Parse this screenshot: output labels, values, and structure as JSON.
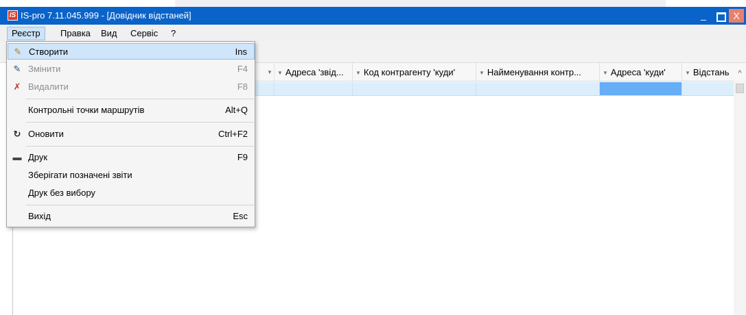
{
  "window": {
    "app_icon_text": "IS",
    "title": "IS-pro 7.11.045.999 - [Довідник відстаней]",
    "minimize_glyph": "_",
    "maximize_icon": "maximize-icon",
    "close_glyph": "X"
  },
  "menubar": {
    "items": [
      {
        "label": "Реєстр",
        "active": true
      },
      {
        "label": "Правка",
        "active": false
      },
      {
        "label": "Вид",
        "active": false
      },
      {
        "label": "Сервіс",
        "active": false
      },
      {
        "label": "?",
        "active": false
      }
    ]
  },
  "dropdown": {
    "items": [
      {
        "label": "Створити",
        "shortcut": "Ins",
        "icon": "new-document-icon",
        "glyph": "✎",
        "selected": true,
        "enabled": true
      },
      {
        "label": "Змінити",
        "shortcut": "F4",
        "icon": "edit-icon",
        "glyph": "✎",
        "selected": false,
        "enabled": false
      },
      {
        "label": "Видалити",
        "shortcut": "F8",
        "icon": "delete-icon",
        "glyph": "✗",
        "selected": false,
        "enabled": false
      },
      {
        "label": "Контрольні точки маршрутів",
        "shortcut": "Alt+Q",
        "icon": "",
        "selected": false,
        "enabled": true
      },
      {
        "label": "Оновити",
        "shortcut": "Ctrl+F2",
        "icon": "refresh-icon",
        "glyph": "↻",
        "selected": false,
        "enabled": true
      },
      {
        "label": "Друк",
        "shortcut": "F9",
        "icon": "print-icon",
        "glyph": "▬",
        "selected": false,
        "enabled": true
      },
      {
        "label": "Зберігати позначені звіти",
        "shortcut": "",
        "icon": "",
        "selected": false,
        "enabled": true
      },
      {
        "label": "Друк без вибору",
        "shortcut": "",
        "icon": "",
        "selected": false,
        "enabled": true
      },
      {
        "label": "Вихід",
        "shortcut": "Esc",
        "icon": "",
        "selected": false,
        "enabled": true
      }
    ]
  },
  "grid": {
    "columns": [
      {
        "label": "",
        "sort_glyph": "▼"
      },
      {
        "label": "Адреса 'звід...",
        "sort_glyph": "▼"
      },
      {
        "label": "Код контрагенту 'куди'",
        "sort_glyph": "▼"
      },
      {
        "label": "Найменування контр...",
        "sort_glyph": "▼"
      },
      {
        "label": "Адреса 'куди'",
        "sort_glyph": "▼"
      },
      {
        "label": "Відстань",
        "sort_glyph": ""
      }
    ],
    "rows": [
      [
        "",
        "",
        "",
        "",
        "",
        ""
      ]
    ]
  },
  "scrollbar": {
    "up_glyph": "^"
  },
  "colors": {
    "titlebar": "#0a63c9",
    "close_button": "#e8806c",
    "selected_row": "#dceefc",
    "selected_cell": "#66aef5",
    "menu_highlight": "#cfe5f9"
  }
}
